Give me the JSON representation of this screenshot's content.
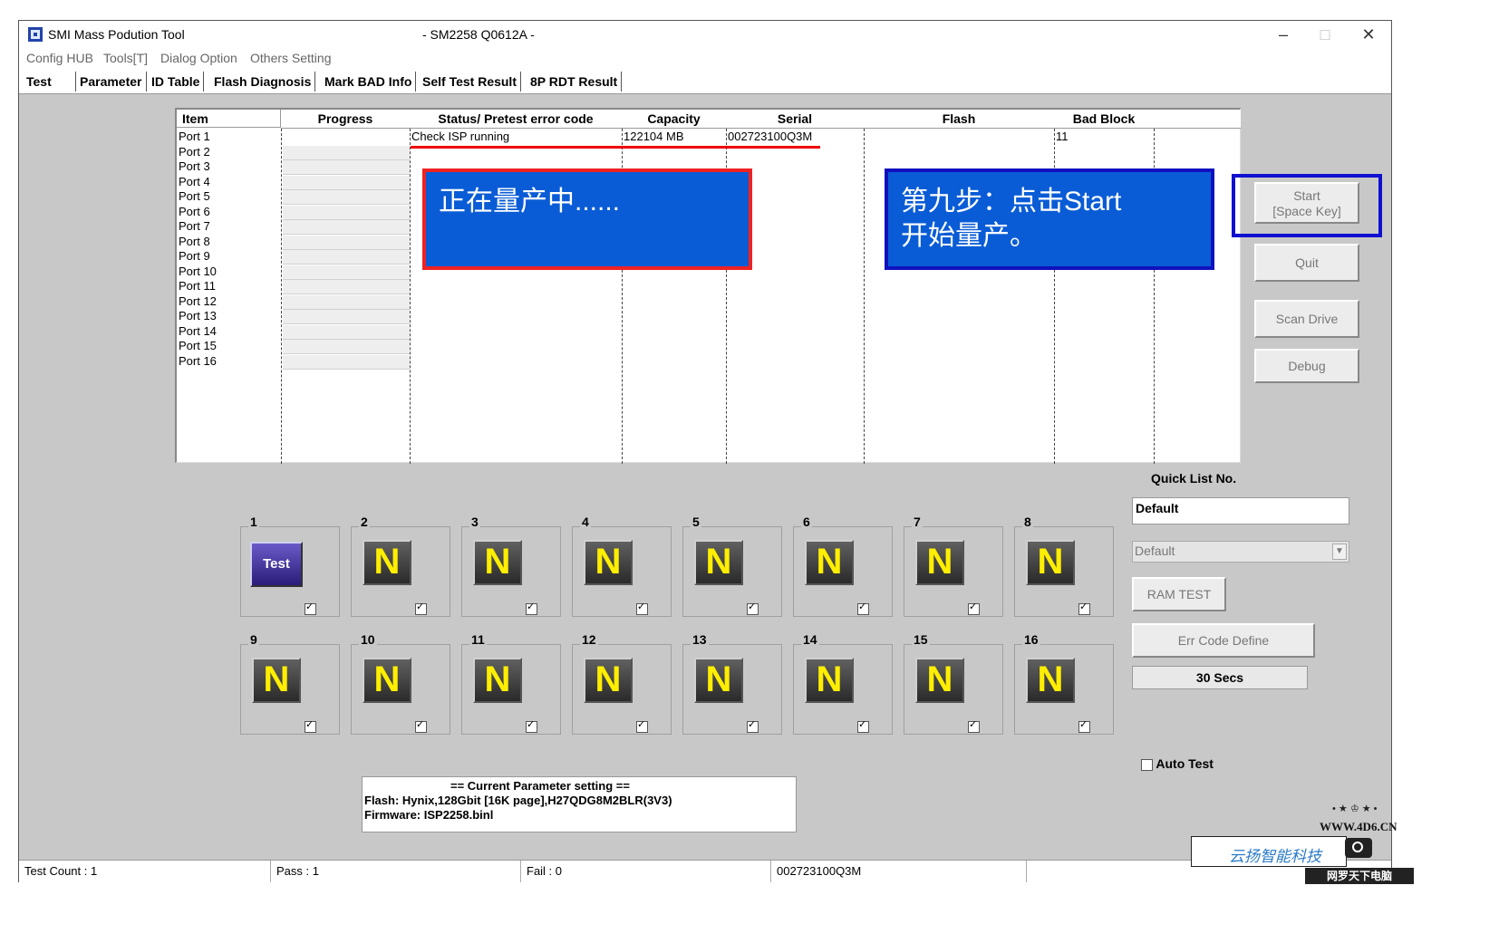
{
  "window": {
    "title": "SMI Mass Podution Tool",
    "center_title": "- SM2258 Q0612A -",
    "controls": [
      "–",
      "□",
      "✕"
    ]
  },
  "menu": [
    "Config HUB",
    "Tools[T]",
    "Dialog Option",
    "Others Setting"
  ],
  "tabs": [
    "Test",
    "Parameter",
    "ID Table",
    "Flash Diagnosis",
    "Mark BAD Info",
    "Self Test Result",
    "8P RDT Result"
  ],
  "grid": {
    "headers": [
      "Item",
      "Progress",
      "Status/ Pretest error code",
      "Capacity",
      "Serial",
      "Flash",
      "Bad Block"
    ],
    "ports": [
      "Port 1",
      "Port 2",
      "Port 3",
      "Port 4",
      "Port 5",
      "Port 6",
      "Port 7",
      "Port 8",
      "Port 9",
      "Port 10",
      "Port 11",
      "Port 12",
      "Port 13",
      "Port 14",
      "Port 15",
      "Port 16"
    ],
    "row1": {
      "status": "Check ISP running",
      "capacity": "122104 MB",
      "serial": "002723100Q3M",
      "bad_block": "11"
    }
  },
  "annotations": {
    "red_callout": "正在量产中......",
    "blue_callout_line1": "第九步：点击Start",
    "blue_callout_line2": "开始量产。"
  },
  "buttons": {
    "start_line1": "Start",
    "start_line2": "[Space Key]",
    "quit": "Quit",
    "scan_drive": "Scan Drive",
    "debug": "Debug",
    "ram_test": "RAM TEST",
    "err_code_define": "Err Code Define"
  },
  "quick_list": {
    "label": "Quick List No.",
    "input_value": "Default",
    "select_value": "Default"
  },
  "timer": "30 Secs",
  "auto_test": {
    "label": "Auto Test",
    "checked": false
  },
  "slots": [
    {
      "num": "1",
      "icon": "Test",
      "checked": true
    },
    {
      "num": "2",
      "icon": "N",
      "checked": true
    },
    {
      "num": "3",
      "icon": "N",
      "checked": true
    },
    {
      "num": "4",
      "icon": "N",
      "checked": true
    },
    {
      "num": "5",
      "icon": "N",
      "checked": true
    },
    {
      "num": "6",
      "icon": "N",
      "checked": true
    },
    {
      "num": "7",
      "icon": "N",
      "checked": true
    },
    {
      "num": "8",
      "icon": "N",
      "checked": true
    },
    {
      "num": "9",
      "icon": "N",
      "checked": true
    },
    {
      "num": "10",
      "icon": "N",
      "checked": true
    },
    {
      "num": "11",
      "icon": "N",
      "checked": true
    },
    {
      "num": "12",
      "icon": "N",
      "checked": true
    },
    {
      "num": "13",
      "icon": "N",
      "checked": true
    },
    {
      "num": "14",
      "icon": "N",
      "checked": true
    },
    {
      "num": "15",
      "icon": "N",
      "checked": true
    },
    {
      "num": "16",
      "icon": "N",
      "checked": true
    }
  ],
  "params": {
    "heading": "== Current Parameter setting ==",
    "flash": "Flash:   Hynix,128Gbit [16K page],H27QDG8M2BLR(3V3)",
    "firmware": "Firmware:   ISP2258.binl"
  },
  "status_bar": {
    "test_count": "Test Count : 1",
    "pass": "Pass : 1",
    "fail": "Fail : 0",
    "serial": "002723100Q3M"
  },
  "watermark": {
    "site": "WWW.4D6.CN",
    "stars": "• ★ ♔ ★ •",
    "chinese": "云扬智能科技",
    "banner": "网罗天下电脑"
  },
  "colors": {
    "callout_fill": "#0a5cd6",
    "red_border": "#e22222",
    "blue_border": "#1010c0",
    "n_icon_text": "#ffee00"
  }
}
